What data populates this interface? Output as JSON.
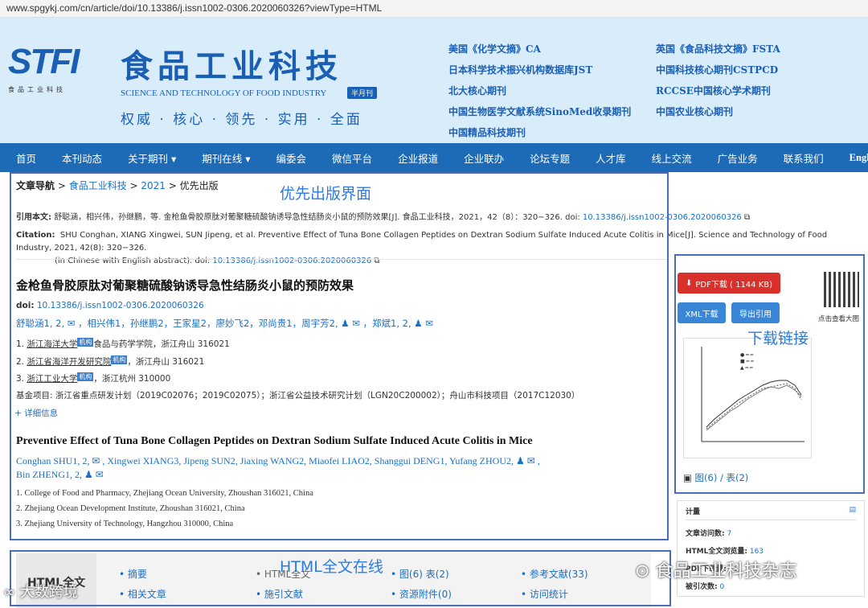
{
  "url": "www.spgykj.com/cn/article/doi/10.13386/j.issn1002-0306.2020060326?viewType=HTML",
  "header": {
    "logo_text": "STFI",
    "logo_sub": "食品工业科技",
    "journal_title": "食品工业科技",
    "journal_en": "SCIENCE AND TECHNOLOGY OF FOOD INDUSTRY",
    "badge": "半月刊",
    "slogan": "权威 · 核心 · 领先 · 实用 · 全面",
    "indexes_left": [
      "美国《化学文摘》CA",
      "日本科学技术振兴机构数据库JST",
      "北大核心期刊",
      "中国生物医学文献系统SinoMed收录期刊",
      "中国精品科技期刊"
    ],
    "indexes_right": [
      "英国《食品科技文摘》FSTA",
      "中国科技核心期刊CSTPCD",
      "RCCSE中国核心学术期刊",
      "中国农业核心期刊"
    ]
  },
  "nav": [
    "首页",
    "本刊动态",
    "关于期刊 ▾",
    "期刊在线 ▾",
    "编委会",
    "微信平台",
    "企业报道",
    "企业联办",
    "论坛专题",
    "人才库",
    "线上交流",
    "广告业务",
    "联系我们",
    "English"
  ],
  "breadcrumb": {
    "label": "文章导航",
    "sep": " > ",
    "l1": "食品工业科技",
    "l2": "2021",
    "l3": "优先出版"
  },
  "citation": {
    "cn_label": "引用本文:",
    "cn_text": "舒聪涵，相兴伟，孙继鹏，等. 金枪鱼骨胶原肽对葡聚糖硫酸钠诱导急性结肠炎小鼠的预防效果[J]. 食品工业科技，2021，42（8）：320−326. doi:",
    "cn_doi": "10.13386/j.issn1002-0306.2020060326",
    "en_label": "Citation:",
    "en_text": "SHU Conghan, XIANG Xingwei, SUN Jipeng, et al. Preventive Effect of Tuna Bone Collagen Peptides on Dextran Sodium Sulfate Induced Acute Colitis in Mice[J]. Science and Technology of Food Industry, 2021, 42(8): 320−326.",
    "en_text2": "(in Chinese with English abstract). doi:",
    "en_doi": "10.13386/j.issn1002-0306.2020060326"
  },
  "article": {
    "title_cn": "金枪鱼骨胶原肽对葡聚糖硫酸钠诱导急性结肠炎小鼠的预防效果",
    "doi_label": "doi:",
    "doi": "10.13386/j.issn1002-0306.2020060326",
    "authors_cn": "舒聪涵1, 2, ✉ ，相兴伟1，孙继鹏2，王家星2，廖妙飞2，邓尚贵1，周宇芳2, ♟ ✉ ，郑斌1, 2, ♟ ✉",
    "aff1_n": "1.",
    "aff1_u": "浙江海洋大学",
    "aff1_rest": "食品与药学学院，浙江舟山 316021",
    "aff2_n": "2.",
    "aff2_u": "浙江省海洋开发研究院",
    "aff2_rest": "，浙江舟山 316021",
    "aff3_n": "3.",
    "aff3_u": "浙江工业大学",
    "aff3_rest": "，浙江杭州 310000",
    "inst_tag": "机构",
    "fund": "基金项目: 浙江省重点研发计划（2019C02076；2019C02075）；浙江省公益技术研究计划（LGN20C200002）；舟山市科技项目（2017C12030）",
    "more": "+ 详细信息",
    "title_en": "Preventive Effect of Tuna Bone Collagen Peptides on Dextran Sodium Sulfate Induced Acute Colitis in Mice",
    "authors_en_1": "Conghan SHU1, 2, ✉ ,   Xingwei XIANG3,   Jipeng SUN2,   Jiaxing WANG2,   Miaofei LIAO2,   Shanggui DENG1,   Yufang ZHOU2, ♟ ✉ ,",
    "authors_en_2": "Bin ZHENG1, 2, ♟ ✉",
    "en_aff1": "1.  College of Food and Pharmacy, Zhejiang Ocean University, Zhoushan 316021, China",
    "en_aff2": "2.  Zhejiang Ocean Development Institute, Zhoushan 316021, China",
    "en_aff3": "3.  Zhejiang University of Technology, Hangzhou 310000, China"
  },
  "sidebar": {
    "pdf": "PDF下载 ( 1144 KB)",
    "xml": "XML下载",
    "export": "导出引用",
    "qr_caption": "点击查看大图",
    "figs": "图(6) / 表(2)",
    "stats_title": "计量",
    "stats": [
      {
        "k": "文章访问数:",
        "v": "7"
      },
      {
        "k": "HTML全文浏览量:",
        "v": "163"
      },
      {
        "k": "PDF下载量:",
        "v": "11"
      },
      {
        "k": "被引次数:",
        "v": "0"
      }
    ]
  },
  "tabs": {
    "title": "HTML全文",
    "items": [
      "摘要",
      "HTML全文",
      "图(6) 表(2)",
      "参考文献(33)",
      "相关文章",
      "施引文献",
      "资源附件(0)",
      "访问统计"
    ]
  },
  "annotations": {
    "a1": "优先出版界面",
    "a2": "下载链接",
    "a3": "HTML全文在线"
  },
  "watermarks": {
    "w1": "食品工业科技杂志",
    "w2": "大数跨境"
  },
  "colors": {
    "nav": "#1d6ab7",
    "header_bg": "#d8ecfa",
    "link": "#1a6fc4",
    "pdf_btn": "#d8302a",
    "annot_box": "#4a6fb8"
  }
}
